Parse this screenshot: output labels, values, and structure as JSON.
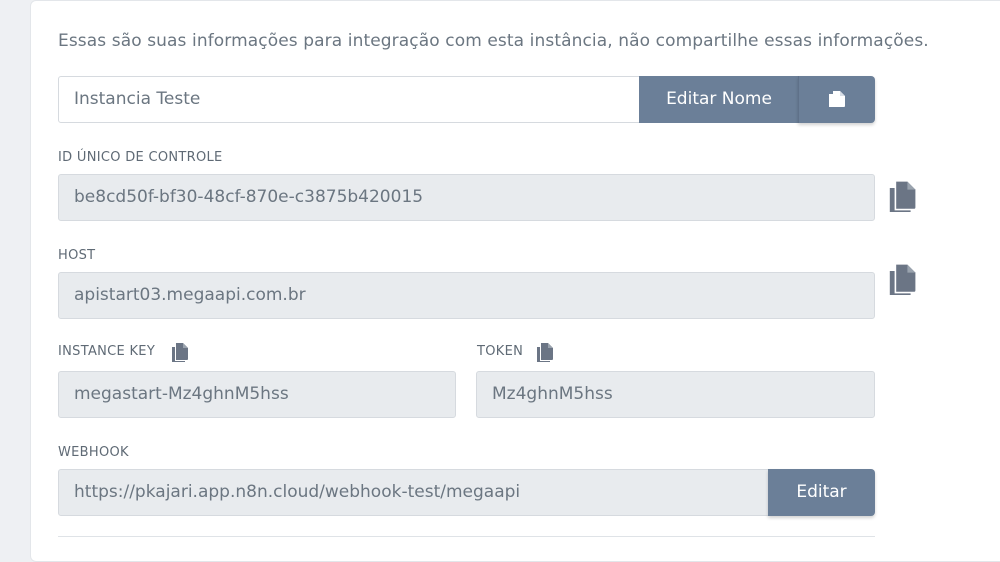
{
  "intro_text": "Essas são suas informações para integração com esta instância, não compartilhe essas informações.",
  "instance_name": {
    "value": "Instancia Teste",
    "edit_button_label": "Editar Nome"
  },
  "control_id": {
    "label": "ID ÚNICO DE CONTROLE",
    "value": "be8cd50f-bf30-48cf-870e-c3875b420015"
  },
  "host": {
    "label": "HOST",
    "value": "apistart03.megaapi.com.br"
  },
  "instance_key": {
    "label": "INSTANCE KEY",
    "value": "megastart-Mz4ghnM5hss"
  },
  "token": {
    "label": "TOKEN",
    "value": "Mz4ghnM5hss"
  },
  "webhook": {
    "label": "WEBHOOK",
    "value": "https://pkajari.app.n8n.cloud/webhook-test/megaapi",
    "edit_button_label": "Editar"
  },
  "colors": {
    "button": "#6b7f98",
    "icon": "#6b7585",
    "field_readonly": "#e8ebee"
  },
  "icons": {
    "copy": "copy-icon"
  }
}
